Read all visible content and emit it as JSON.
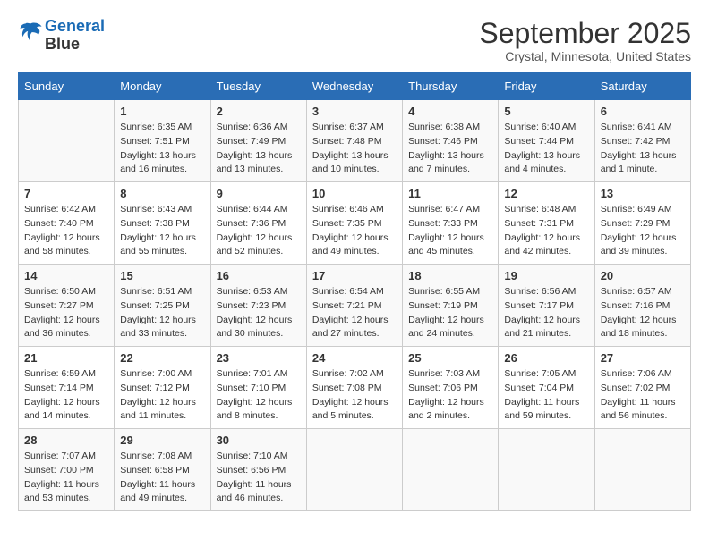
{
  "logo": {
    "line1": "General",
    "line2": "Blue"
  },
  "title": "September 2025",
  "subtitle": "Crystal, Minnesota, United States",
  "days_of_week": [
    "Sunday",
    "Monday",
    "Tuesday",
    "Wednesday",
    "Thursday",
    "Friday",
    "Saturday"
  ],
  "weeks": [
    [
      {
        "day": "",
        "info": ""
      },
      {
        "day": "1",
        "info": "Sunrise: 6:35 AM\nSunset: 7:51 PM\nDaylight: 13 hours\nand 16 minutes."
      },
      {
        "day": "2",
        "info": "Sunrise: 6:36 AM\nSunset: 7:49 PM\nDaylight: 13 hours\nand 13 minutes."
      },
      {
        "day": "3",
        "info": "Sunrise: 6:37 AM\nSunset: 7:48 PM\nDaylight: 13 hours\nand 10 minutes."
      },
      {
        "day": "4",
        "info": "Sunrise: 6:38 AM\nSunset: 7:46 PM\nDaylight: 13 hours\nand 7 minutes."
      },
      {
        "day": "5",
        "info": "Sunrise: 6:40 AM\nSunset: 7:44 PM\nDaylight: 13 hours\nand 4 minutes."
      },
      {
        "day": "6",
        "info": "Sunrise: 6:41 AM\nSunset: 7:42 PM\nDaylight: 13 hours\nand 1 minute."
      }
    ],
    [
      {
        "day": "7",
        "info": "Sunrise: 6:42 AM\nSunset: 7:40 PM\nDaylight: 12 hours\nand 58 minutes."
      },
      {
        "day": "8",
        "info": "Sunrise: 6:43 AM\nSunset: 7:38 PM\nDaylight: 12 hours\nand 55 minutes."
      },
      {
        "day": "9",
        "info": "Sunrise: 6:44 AM\nSunset: 7:36 PM\nDaylight: 12 hours\nand 52 minutes."
      },
      {
        "day": "10",
        "info": "Sunrise: 6:46 AM\nSunset: 7:35 PM\nDaylight: 12 hours\nand 49 minutes."
      },
      {
        "day": "11",
        "info": "Sunrise: 6:47 AM\nSunset: 7:33 PM\nDaylight: 12 hours\nand 45 minutes."
      },
      {
        "day": "12",
        "info": "Sunrise: 6:48 AM\nSunset: 7:31 PM\nDaylight: 12 hours\nand 42 minutes."
      },
      {
        "day": "13",
        "info": "Sunrise: 6:49 AM\nSunset: 7:29 PM\nDaylight: 12 hours\nand 39 minutes."
      }
    ],
    [
      {
        "day": "14",
        "info": "Sunrise: 6:50 AM\nSunset: 7:27 PM\nDaylight: 12 hours\nand 36 minutes."
      },
      {
        "day": "15",
        "info": "Sunrise: 6:51 AM\nSunset: 7:25 PM\nDaylight: 12 hours\nand 33 minutes."
      },
      {
        "day": "16",
        "info": "Sunrise: 6:53 AM\nSunset: 7:23 PM\nDaylight: 12 hours\nand 30 minutes."
      },
      {
        "day": "17",
        "info": "Sunrise: 6:54 AM\nSunset: 7:21 PM\nDaylight: 12 hours\nand 27 minutes."
      },
      {
        "day": "18",
        "info": "Sunrise: 6:55 AM\nSunset: 7:19 PM\nDaylight: 12 hours\nand 24 minutes."
      },
      {
        "day": "19",
        "info": "Sunrise: 6:56 AM\nSunset: 7:17 PM\nDaylight: 12 hours\nand 21 minutes."
      },
      {
        "day": "20",
        "info": "Sunrise: 6:57 AM\nSunset: 7:16 PM\nDaylight: 12 hours\nand 18 minutes."
      }
    ],
    [
      {
        "day": "21",
        "info": "Sunrise: 6:59 AM\nSunset: 7:14 PM\nDaylight: 12 hours\nand 14 minutes."
      },
      {
        "day": "22",
        "info": "Sunrise: 7:00 AM\nSunset: 7:12 PM\nDaylight: 12 hours\nand 11 minutes."
      },
      {
        "day": "23",
        "info": "Sunrise: 7:01 AM\nSunset: 7:10 PM\nDaylight: 12 hours\nand 8 minutes."
      },
      {
        "day": "24",
        "info": "Sunrise: 7:02 AM\nSunset: 7:08 PM\nDaylight: 12 hours\nand 5 minutes."
      },
      {
        "day": "25",
        "info": "Sunrise: 7:03 AM\nSunset: 7:06 PM\nDaylight: 12 hours\nand 2 minutes."
      },
      {
        "day": "26",
        "info": "Sunrise: 7:05 AM\nSunset: 7:04 PM\nDaylight: 11 hours\nand 59 minutes."
      },
      {
        "day": "27",
        "info": "Sunrise: 7:06 AM\nSunset: 7:02 PM\nDaylight: 11 hours\nand 56 minutes."
      }
    ],
    [
      {
        "day": "28",
        "info": "Sunrise: 7:07 AM\nSunset: 7:00 PM\nDaylight: 11 hours\nand 53 minutes."
      },
      {
        "day": "29",
        "info": "Sunrise: 7:08 AM\nSunset: 6:58 PM\nDaylight: 11 hours\nand 49 minutes."
      },
      {
        "day": "30",
        "info": "Sunrise: 7:10 AM\nSunset: 6:56 PM\nDaylight: 11 hours\nand 46 minutes."
      },
      {
        "day": "",
        "info": ""
      },
      {
        "day": "",
        "info": ""
      },
      {
        "day": "",
        "info": ""
      },
      {
        "day": "",
        "info": ""
      }
    ]
  ]
}
